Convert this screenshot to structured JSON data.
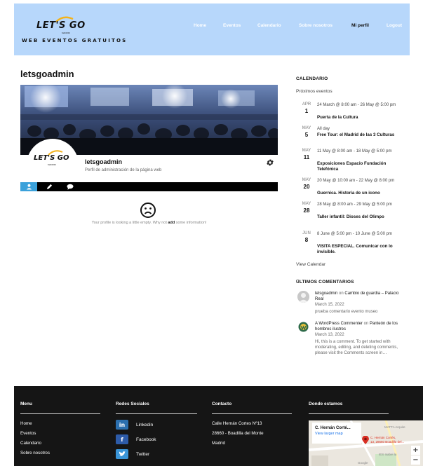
{
  "header": {
    "logo_text": "LET'S GO",
    "logo_sub": "MADRID",
    "tagline": "WEB EVENTOS GRATUITOS",
    "nav": [
      "Home",
      "Eventos",
      "Calendario",
      "Sobre nosotros",
      "Mi perfil",
      "Logout"
    ],
    "active_nav": "Mi perfil",
    "bg_color": "#b7d7fb"
  },
  "profile": {
    "page_title": "letsgoadmin",
    "name": "letsgoadmin",
    "description": "Perfil de administración de la página web",
    "tabs": [
      "user-icon",
      "pencil-icon",
      "comment-icon"
    ],
    "empty_msg_before": "Your profile is looking a little empty. Why not ",
    "empty_msg_link": "add",
    "empty_msg_after": " some information!",
    "accent_color": "#3ba1da"
  },
  "sidebar": {
    "calendar_heading": "CALENDARIO",
    "calendar_sub": "Próximos eventos",
    "events": [
      {
        "month": "APR",
        "day": "1",
        "time": "24 March @ 8:00 am - 26 May @ 5:00 pm",
        "title": "Puerta de la Cultura"
      },
      {
        "month": "MAY",
        "day": "5",
        "time": "All day",
        "title": "Free Tour: el Madrid de las 3 Culturas"
      },
      {
        "month": "MAY",
        "day": "11",
        "time": "11 May @ 8:00 am - 18 May @ 5:00 pm",
        "title": "Exposiciones Espacio Fundación Telefónica"
      },
      {
        "month": "MAY",
        "day": "20",
        "time": "20 May @ 10:00 am - 22 May @ 8:00 pm",
        "title": "Guernica. Historia de un icono"
      },
      {
        "month": "MAY",
        "day": "28",
        "time": "28 May @ 8:00 am - 29 May @ 5:00 pm",
        "title": "Taller infantil: Dioses del Olimpo"
      },
      {
        "month": "JUN",
        "day": "8",
        "time": "8 June @ 5:00 pm - 10 June @ 5:00 pm",
        "title": "VISITA ESPECIAL. Comunicar con lo invisible."
      }
    ],
    "view_calendar": "View Calendar",
    "comments_heading": "ÚLTIMOS COMENTARIOS",
    "comments": [
      {
        "author": "letsgoadmin",
        "on": " on ",
        "post": "Cambio de guardia – Palacio Real",
        "date": "March 15, 2022",
        "body": "prueba comentario evento museo"
      },
      {
        "author": "A WordPress Commenter",
        "on": " on ",
        "post": "Panteón de los hombres ilustres",
        "date": "March 13, 2022",
        "body": "Hi, this is a comment. To get started with moderating, editing, and deleting comments, please visit the Comments screen in…"
      }
    ]
  },
  "footer": {
    "menu_heading": "Menu",
    "menu_items": [
      "Home",
      "Eventos",
      "Calendario",
      "Sobre nosotros"
    ],
    "social_heading": "Redes Sociales",
    "social": [
      {
        "icon": "linkedin-icon",
        "glyph": "in",
        "label": "Linkedin",
        "color": "#2b6fae"
      },
      {
        "icon": "facebook-icon",
        "glyph": "f",
        "label": "Facebook",
        "color": "#2d5ba8"
      },
      {
        "icon": "twitter-icon",
        "glyph": "t",
        "label": "Twitter",
        "color": "#3a95d8"
      }
    ],
    "contact_heading": "Contacto",
    "contact_lines": [
      "Calle Hernán Cortes Nº13",
      "28660 - Boadilla del Monte",
      "Madrid"
    ],
    "map_heading": "Donde estamos",
    "map": {
      "place_name": "C. Hernán Corté...",
      "larger_map": "View larger map",
      "pin_label_1": "C. Hernán Cortés,",
      "pin_label_2": "13, 28660 Boadilla del...",
      "poi": "MATTA Arquite",
      "school": "IES Isabel la",
      "brand": "Google",
      "zoom_in": "+",
      "zoom_out": "−"
    }
  }
}
